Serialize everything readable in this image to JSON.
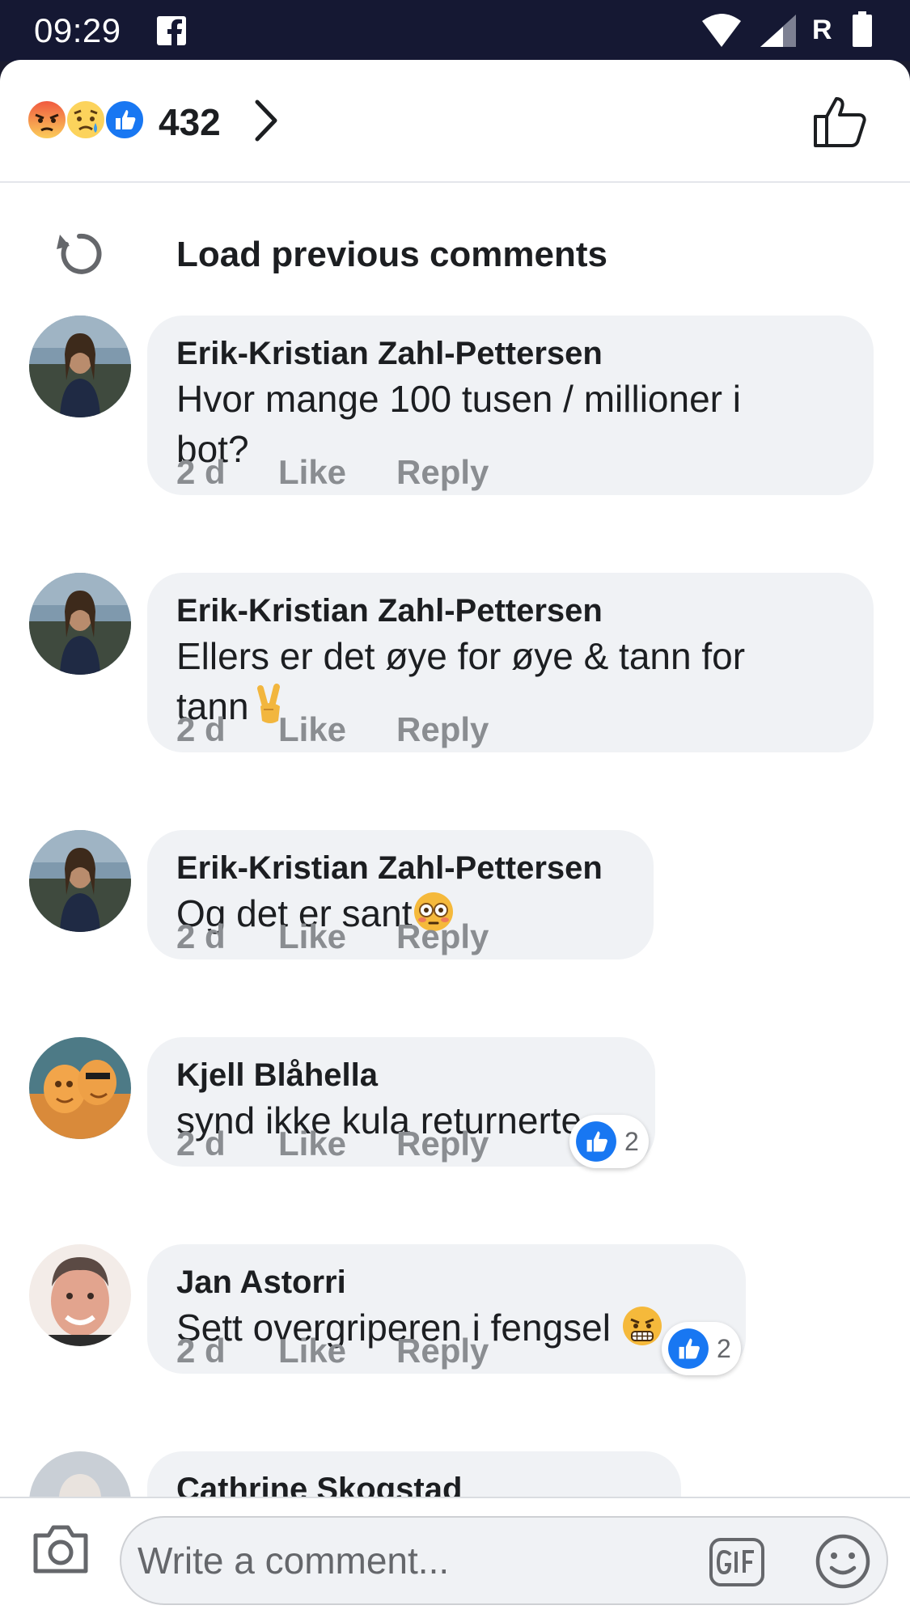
{
  "status_bar": {
    "time": "09:29",
    "app_icon": "facebook-icon",
    "network_label": "R"
  },
  "reactions": {
    "emojis": [
      "angry-emoji",
      "sad-emoji",
      "like-emoji"
    ],
    "count": "432",
    "chevron": "chevron-right-icon",
    "like_button_icon": "thumbs-up-icon"
  },
  "load_previous": {
    "label": "Load previous comments",
    "icon": "refresh-icon"
  },
  "comments": [
    {
      "author": "Erik-Kristian Zahl-Pettersen",
      "text": "Hvor mange 100 tusen / millioner i bot?",
      "text_lines": [
        "Hvor mange 100 tusen / millioner i",
        "bot?"
      ],
      "time": "2 d",
      "like_label": "Like",
      "reply_label": "Reply"
    },
    {
      "author": "Erik-Kristian Zahl-Pettersen",
      "text": "Ellers er det øye for øye & tann for tann✌️",
      "text_lines": [
        "Ellers er det øye for øye & tann for",
        "tann"
      ],
      "emoji": "victory-hand-emoji",
      "time": "2 d",
      "like_label": "Like",
      "reply_label": "Reply"
    },
    {
      "author": "Erik-Kristian Zahl-Pettersen",
      "text": "Og det er sant😳",
      "text_lines": [
        "Og det er sant"
      ],
      "emoji": "flushed-face-emoji",
      "time": "2 d",
      "like_label": "Like",
      "reply_label": "Reply"
    },
    {
      "author": "Kjell Blåhella",
      "text": "synd ikke kula returnerte",
      "text_lines": [
        "synd ikke kula returnerte"
      ],
      "time": "2 d",
      "like_label": "Like",
      "reply_label": "Reply",
      "reaction_count": "2"
    },
    {
      "author": "Jan Astorri",
      "text": "Sett overgriperen i fengsel 😬",
      "text_lines": [
        "Sett overgriperen i fengsel "
      ],
      "emoji": "grimacing-face-emoji",
      "time": "2 d",
      "like_label": "Like",
      "reply_label": "Reply",
      "reaction_count": "2"
    },
    {
      "author": "Cathrine Skogstad"
    }
  ],
  "composer": {
    "placeholder": "Write a comment...",
    "camera_icon": "camera-icon",
    "gif_icon": "gif-icon",
    "emoji_icon": "smiley-icon"
  }
}
